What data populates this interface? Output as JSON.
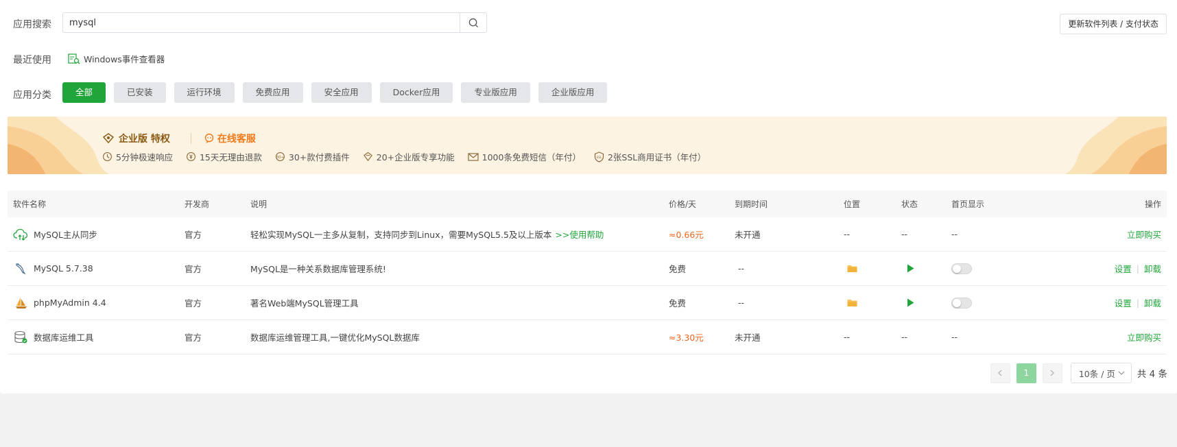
{
  "search": {
    "label": "应用搜索",
    "value": "mysql",
    "placeholder": ""
  },
  "update_button": "更新软件列表 / 支付状态",
  "recent": {
    "label": "最近使用",
    "item": "Windows事件查看器"
  },
  "categories": {
    "label": "应用分类",
    "items": [
      "全部",
      "已安装",
      "运行环境",
      "免费应用",
      "安全应用",
      "Docker应用",
      "专业版应用",
      "企业版应用"
    ],
    "active": 0
  },
  "banner": {
    "title": "企业版 特权",
    "service": "在线客服",
    "features": [
      "5分钟极速响应",
      "15天无理由退款",
      "30+款付费插件",
      "20+企业版专享功能",
      "1000条免费短信（年付）",
      "2张SSL商用证书（年付）"
    ]
  },
  "table": {
    "headers": [
      "软件名称",
      "开发商",
      "说明",
      "价格/天",
      "到期时间",
      "位置",
      "状态",
      "首页显示",
      "操作"
    ],
    "rows": [
      {
        "name": "MySQL主从同步",
        "icon": "cloud-sync-icon",
        "dev": "官方",
        "desc": "轻松实现MySQL一主多从复制，支持同步到Linux，需要MySQL5.5及以上版本",
        "help": ">>使用帮助",
        "price": "≈0.66元",
        "expire": "未开通",
        "loc": "--",
        "status": "--",
        "home": "--",
        "ops": [
          "立即购买"
        ]
      },
      {
        "name": "MySQL 5.7.38",
        "icon": "dolphin-icon",
        "dev": "官方",
        "desc": "MySQL是一种关系数据库管理系统!",
        "help": "",
        "price": "免费",
        "expire": "--",
        "loc": "folder",
        "status": "play",
        "home": "toggle",
        "ops": [
          "设置",
          "卸载"
        ]
      },
      {
        "name": "phpMyAdmin 4.4",
        "icon": "sailboat-icon",
        "dev": "官方",
        "desc": "著名Web端MySQL管理工具",
        "help": "",
        "price": "免费",
        "expire": "--",
        "loc": "folder",
        "status": "play",
        "home": "toggle",
        "ops": [
          "设置",
          "卸载"
        ]
      },
      {
        "name": "数据库运维工具",
        "icon": "database-tool-icon",
        "dev": "官方",
        "desc": "数据库运维管理工具,一键优化MySQL数据库",
        "help": "",
        "price": "≈3.30元",
        "expire": "未开通",
        "loc": "--",
        "status": "--",
        "home": "--",
        "ops": [
          "立即购买"
        ]
      }
    ]
  },
  "pagination": {
    "current": "1",
    "page_size": "10条 / 页",
    "total": "共 4 条"
  },
  "colors": {
    "accent": "#20a53a",
    "price": "#f0641d",
    "banner_bg": "#fdf3e3",
    "folder": "#f5c35b"
  }
}
